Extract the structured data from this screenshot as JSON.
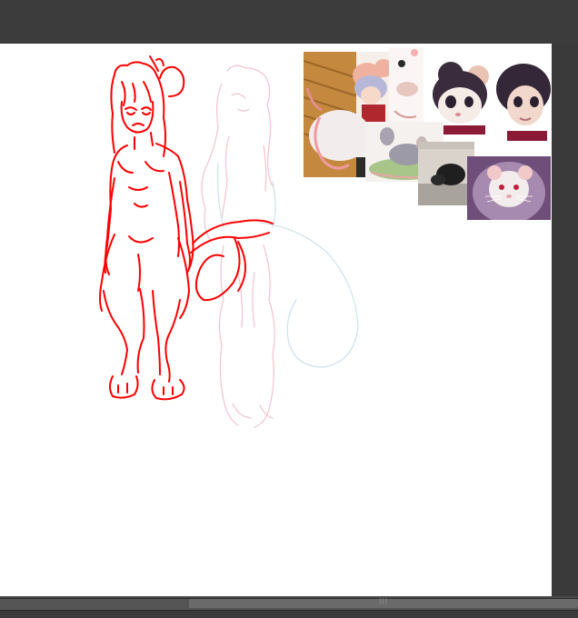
{
  "app": {
    "colors": {
      "workspace": "#3b3b3b",
      "canvas": "#ffffff",
      "sketch_red": "#ff0000",
      "sketch_light": "#f3c2cc",
      "sketch_blue": "#cfe3ef"
    }
  },
  "canvas": {
    "layers": [
      "red-lineart-layer",
      "pink-rough-sketch-layer",
      "blue-tail-sketch-layer"
    ],
    "references": [
      {
        "name": "reference-anime-mouse-girl"
      },
      {
        "name": "reference-small-sketches"
      },
      {
        "name": "reference-mouse-character-faces"
      },
      {
        "name": "reference-rat-on-grass"
      },
      {
        "name": "reference-black-rat-photo"
      },
      {
        "name": "reference-white-rat-photo"
      }
    ]
  },
  "scrollbar": {
    "grip_icon": "grip-lines-icon",
    "grip": "|||"
  }
}
